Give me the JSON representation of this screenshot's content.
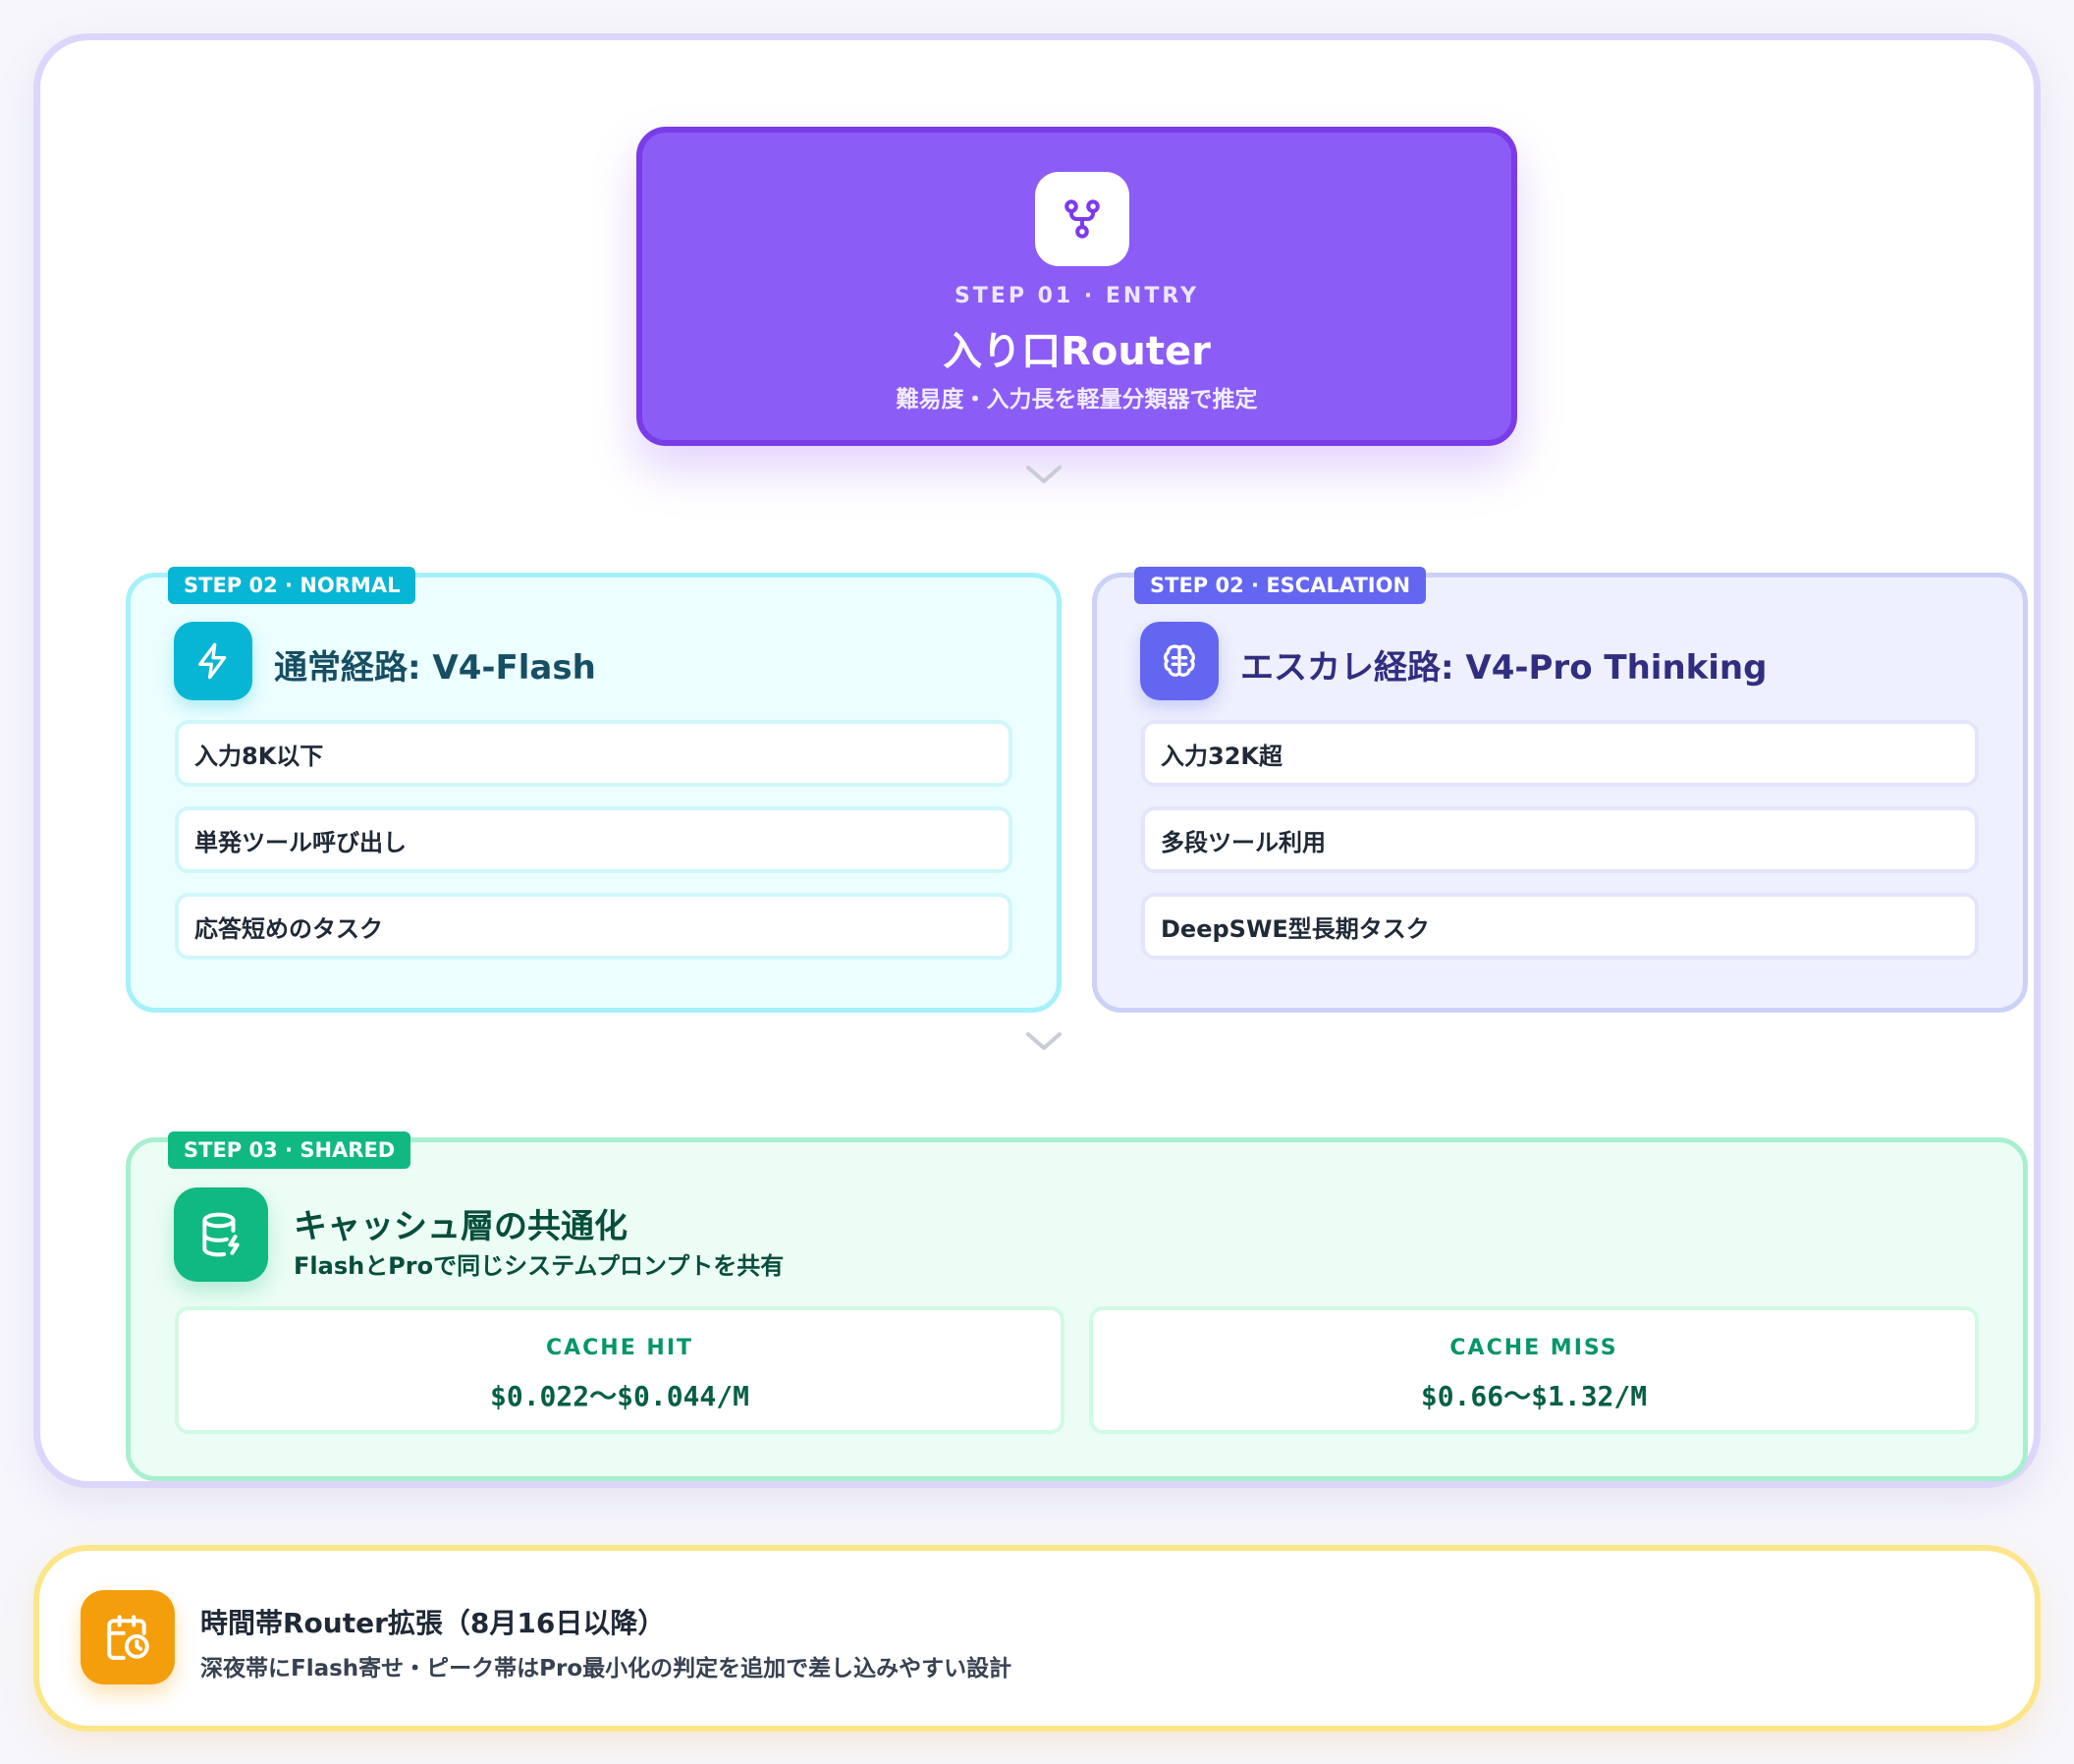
{
  "entry": {
    "step": "STEP 01 · ENTRY",
    "title": "入り口Router",
    "subtitle": "難易度・入力長を軽量分類器で推定",
    "icon": "git-fork-icon"
  },
  "normal": {
    "badge": "STEP 02 · NORMAL",
    "title": "通常経路: V4-Flash",
    "icon": "zap-icon",
    "items": [
      "入力8K以下",
      "単発ツール呼び出し",
      "応答短めのタスク"
    ]
  },
  "escalation": {
    "badge": "STEP 02 · ESCALATION",
    "title": "エスカレ経路: V4-Pro Thinking",
    "icon": "brain-icon",
    "items": [
      "入力32K超",
      "多段ツール利用",
      "DeepSWE型長期タスク"
    ]
  },
  "shared": {
    "badge": "STEP 03 · SHARED",
    "title": "キャッシュ層の共通化",
    "subtitle": "FlashとProで同じシステムプロンプトを共有",
    "icon": "database-zap-icon",
    "cache_hit": {
      "label": "CACHE HIT",
      "value": "$0.022〜$0.044/M"
    },
    "cache_miss": {
      "label": "CACHE MISS",
      "value": "$0.66〜$1.32/M"
    }
  },
  "extension": {
    "title": "時間帯Router拡張（8月16日以降）",
    "subtitle": "深夜帯にFlash寄せ・ピーク帯はPro最小化の判定を追加で差し込みやすい設計",
    "icon": "calendar-clock-icon"
  },
  "colors": {
    "entry": "#8b5cf6",
    "normal": "#06b6d4",
    "escalation": "#6366f1",
    "shared": "#10b981",
    "extension": "#f59e0b"
  }
}
